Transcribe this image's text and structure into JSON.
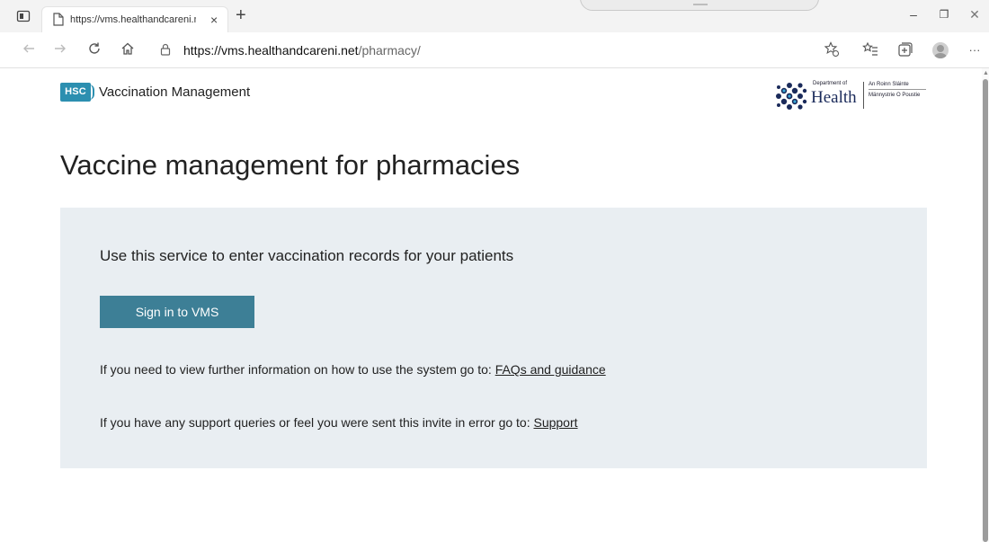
{
  "browser": {
    "tab_title": "https://vms.healthandcareni.net/",
    "tab_close": "×",
    "new_tab": "+",
    "url_host": "https://vms.healthandcareni.net",
    "url_path": "/pharmacy/",
    "window_controls": {
      "minimize": "–",
      "maximize": "❐",
      "close": "✕"
    },
    "more": "···"
  },
  "header": {
    "hsc_logo_text": "HSC",
    "site_title": "Vaccination Management",
    "doh_logo": {
      "small_top": "Department of",
      "main": "Health",
      "irish": "An Roinn Sláinte",
      "ulster": "Männystrie O Poustie"
    }
  },
  "main": {
    "title": "Vaccine management for pharmacies",
    "lead": "Use this service to enter vaccination records for your patients",
    "sign_in_label": "Sign in to VMS",
    "info_text": "If you need to view further information on how to use the system go to:",
    "info_link": "FAQs and guidance",
    "support_text": "If you have any support queries or feel you were sent this invite in error go to:",
    "support_link": "Support"
  },
  "colors": {
    "accent": "#3d7f96",
    "panel_bg": "#e9eef2",
    "hsc_blue": "#2c8fb0"
  }
}
